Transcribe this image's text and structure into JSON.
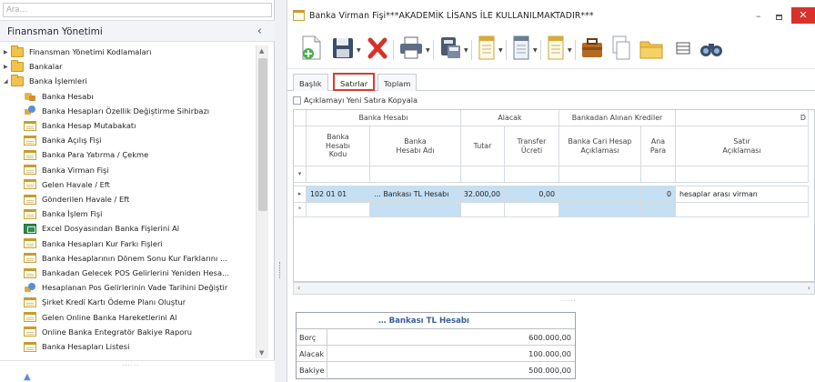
{
  "left_panel": {
    "search_placeholder": "Ara...",
    "title": "Finansman Yönetimi",
    "collapse_glyph": "‹",
    "tree": [
      {
        "label": "Finansman Yönetimi Kodlamaları",
        "icon": "folder-icon",
        "level": 0,
        "expander": "collapsed"
      },
      {
        "label": "Bankalar",
        "icon": "folder-icon",
        "level": 0,
        "expander": "collapsed"
      },
      {
        "label": "Banka İşlemleri",
        "icon": "folder-icon",
        "level": 0,
        "expander": "expanded"
      },
      {
        "label": "Banka Hesabı",
        "icon": "bank-account-icon",
        "level": 1
      },
      {
        "label": "Banka Hesapları Özellik Değiştirme Sihirbazı",
        "icon": "wizard-icon",
        "level": 1
      },
      {
        "label": "Banka Hesap Mutabakatı",
        "icon": "form-icon",
        "level": 1
      },
      {
        "label": "Banka Açılış Fişi",
        "icon": "form-icon",
        "level": 1
      },
      {
        "label": "Banka Para Yatırma / Çekme",
        "icon": "form-icon",
        "level": 1
      },
      {
        "label": "Banka Virman Fişi",
        "icon": "form-icon",
        "level": 1
      },
      {
        "label": "Gelen Havale / Eft",
        "icon": "form-icon",
        "level": 1
      },
      {
        "label": "Gönderilen Havale / Eft",
        "icon": "form-icon",
        "level": 1
      },
      {
        "label": "Banka İşlem Fişi",
        "icon": "form-icon",
        "level": 1
      },
      {
        "label": "Excel Dosyasından Banka Fişlerini Al",
        "icon": "excel-icon",
        "level": 1
      },
      {
        "label": "Banka Hesapları Kur Farkı Fişleri",
        "icon": "form-icon",
        "level": 1
      },
      {
        "label": "Banka Hesaplarının Dönem Sonu Kur Farklarını ...",
        "icon": "form-icon",
        "level": 1
      },
      {
        "label": "Bankadan Gelecek POS Gelirlerini Yeniden Hesa...",
        "icon": "form-icon",
        "level": 1
      },
      {
        "label": "Hesaplanan Pos Gelirlerinin Vade Tarihini Değiştir",
        "icon": "wizard-icon",
        "level": 1
      },
      {
        "label": "Şirket Kredi Kartı Ödeme Planı Oluştur",
        "icon": "form-icon",
        "level": 1
      },
      {
        "label": "Gelen Online Banka Hareketlerini Al",
        "icon": "form-icon",
        "level": 1
      },
      {
        "label": "Online Banka Entegratör Bakiye Raporu",
        "icon": "form-icon",
        "level": 1
      },
      {
        "label": "Banka Hesapları Listesi",
        "icon": "form-icon",
        "level": 1
      }
    ]
  },
  "window": {
    "title": "Banka Virman Fişi***AKADEMİK LİSANS İLE KULLANILMAKTADIR***",
    "minimize": "–",
    "close": "✕"
  },
  "toolbar": {
    "buttons": [
      "new-document-icon",
      "save-icon",
      "delete-icon",
      "print-icon",
      "calculator-icon",
      "report-icon",
      "list-icon",
      "form-icon",
      "briefcase-icon",
      "copy-icon",
      "folder-icon",
      "grid-icon",
      "binoculars-icon"
    ]
  },
  "tabs": [
    {
      "label": "Başlık",
      "active": false
    },
    {
      "label": "Satırlar",
      "active": true
    },
    {
      "label": "Toplam",
      "active": false
    }
  ],
  "copy_checkbox": {
    "label": "Açıklamayı Yeni Satıra Kopyala",
    "checked": false
  },
  "grid": {
    "group_headers": [
      "Banka Hesabı",
      "Alacak",
      "Bankadan Alınan Krediler",
      "D"
    ],
    "columns": [
      "Banka Hesabı Kodu",
      "Banka Hesabı Adı",
      "Tutar",
      "Transfer Ücreti",
      "Banka Cari Hesap Açıklaması",
      "Ana Para",
      "Satır Açıklaması"
    ],
    "rows": [
      {
        "indicator": "▸",
        "code": "102 01 01",
        "name": "… Bankası TL Hesabı",
        "amount": "32.000,00",
        "fee": "0,00",
        "cari": "",
        "principal": "0",
        "desc": "hesaplar arası virman"
      }
    ],
    "filter_indicator": "▾",
    "new_row_indicator": "*"
  },
  "summary": {
    "title": "… Bankası TL Hesabı",
    "rows": [
      {
        "label": "Borç",
        "value": "600.000,00"
      },
      {
        "label": "Alacak",
        "value": "100.000,00"
      },
      {
        "label": "Bakiye",
        "value": "500.000,00"
      }
    ]
  }
}
